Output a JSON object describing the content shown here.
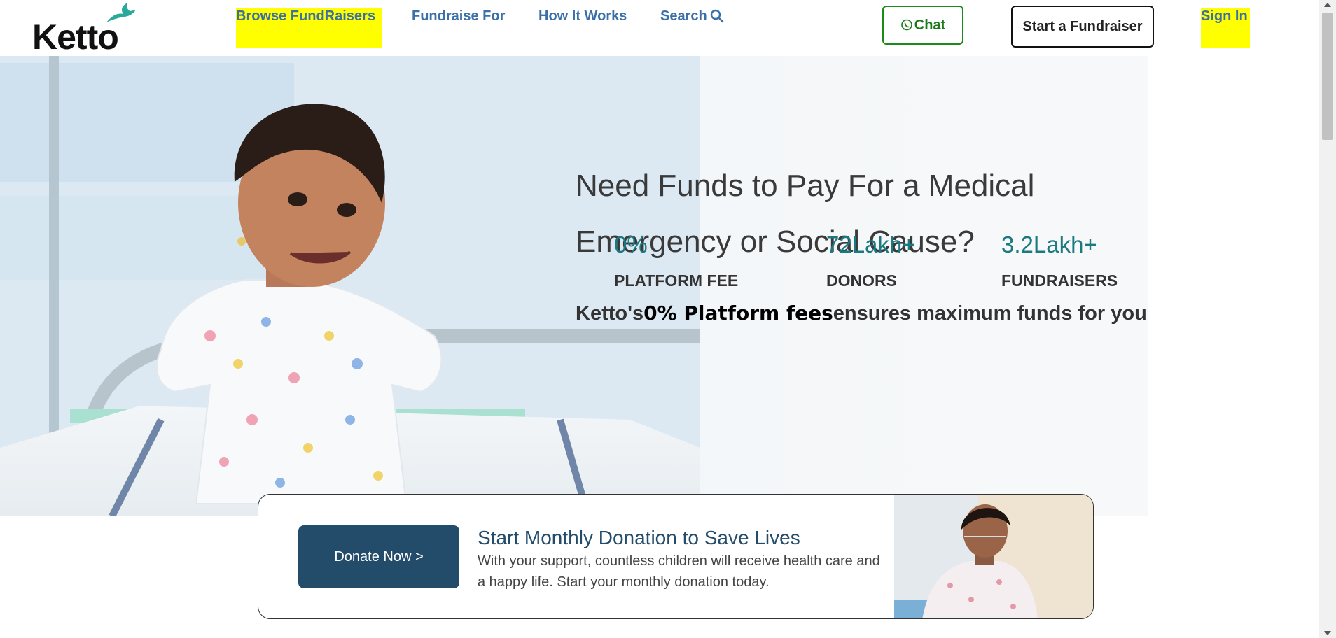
{
  "header": {
    "logo_text": "Ketto",
    "nav": {
      "browse": "Browse FundRaisers",
      "fundraise_for": "Fundraise For",
      "how_it_works": "How It Works",
      "search": "Search"
    },
    "chat_label": "Chat",
    "start_fundraiser_label": "Start a Fundraiser",
    "sign_in_label": "Sign In"
  },
  "hero": {
    "title": "Need Funds to Pay For a Medical Emergency or Social Cause?",
    "stats": [
      {
        "value": "0%",
        "label": "PLATFORM FEE"
      },
      {
        "value": "72Lakh+",
        "label": "DONORS"
      },
      {
        "value": "3.2Lakh+",
        "label": "FUNDRAISERS"
      }
    ],
    "tagline": {
      "prefix": "Ketto's",
      "bold": "0% Platform fees",
      "suffix": "ensures maximum funds for you"
    }
  },
  "donation_card": {
    "button_label": "Donate Now >",
    "title": "Start Monthly Donation to Save Lives",
    "text": "With your support, countless children will receive health care and a happy life. Start your monthly donation today."
  },
  "colors": {
    "highlight": "#ffff00",
    "nav_blue": "#3a6fa8",
    "stat_teal": "#1a7a80",
    "chat_green": "#1a8a1a",
    "donate_navy": "#234b6a"
  },
  "icons": {
    "logo_bird": "bird-icon",
    "search": "search-icon",
    "chat": "whatsapp-icon"
  }
}
